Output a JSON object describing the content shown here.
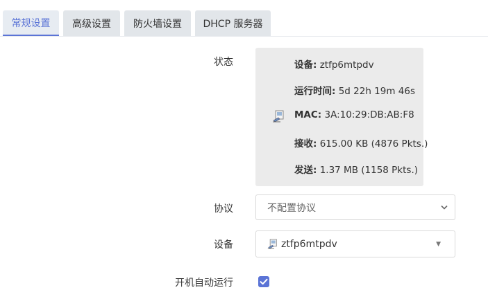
{
  "tabs": [
    {
      "label": "常规设置",
      "active": true
    },
    {
      "label": "高级设置"
    },
    {
      "label": "防火墙设置"
    },
    {
      "label": "DHCP 服务器"
    }
  ],
  "status": {
    "label": "状态",
    "device_key": "设备:",
    "device_val": "ztfp6mtpdv",
    "uptime_key": "运行时间:",
    "uptime_val": "5d 22h 19m 46s",
    "mac_key": "MAC:",
    "mac_val": "3A:10:29:DB:AB:F8",
    "rx_key": "接收:",
    "rx_val": "615.00 KB (4876 Pkts.)",
    "tx_key": "发送:",
    "tx_val": "1.37 MB (1158 Pkts.)"
  },
  "protocol": {
    "label": "协议",
    "value": "不配置协议"
  },
  "device": {
    "label": "设备",
    "value": "ztfp6mtpdv"
  },
  "autostart": {
    "label": "开机自动运行",
    "checked": true
  },
  "colors": {
    "accent": "#5b74d6",
    "tab_bg": "#e2e6ea",
    "status_bg": "#ebebeb"
  }
}
